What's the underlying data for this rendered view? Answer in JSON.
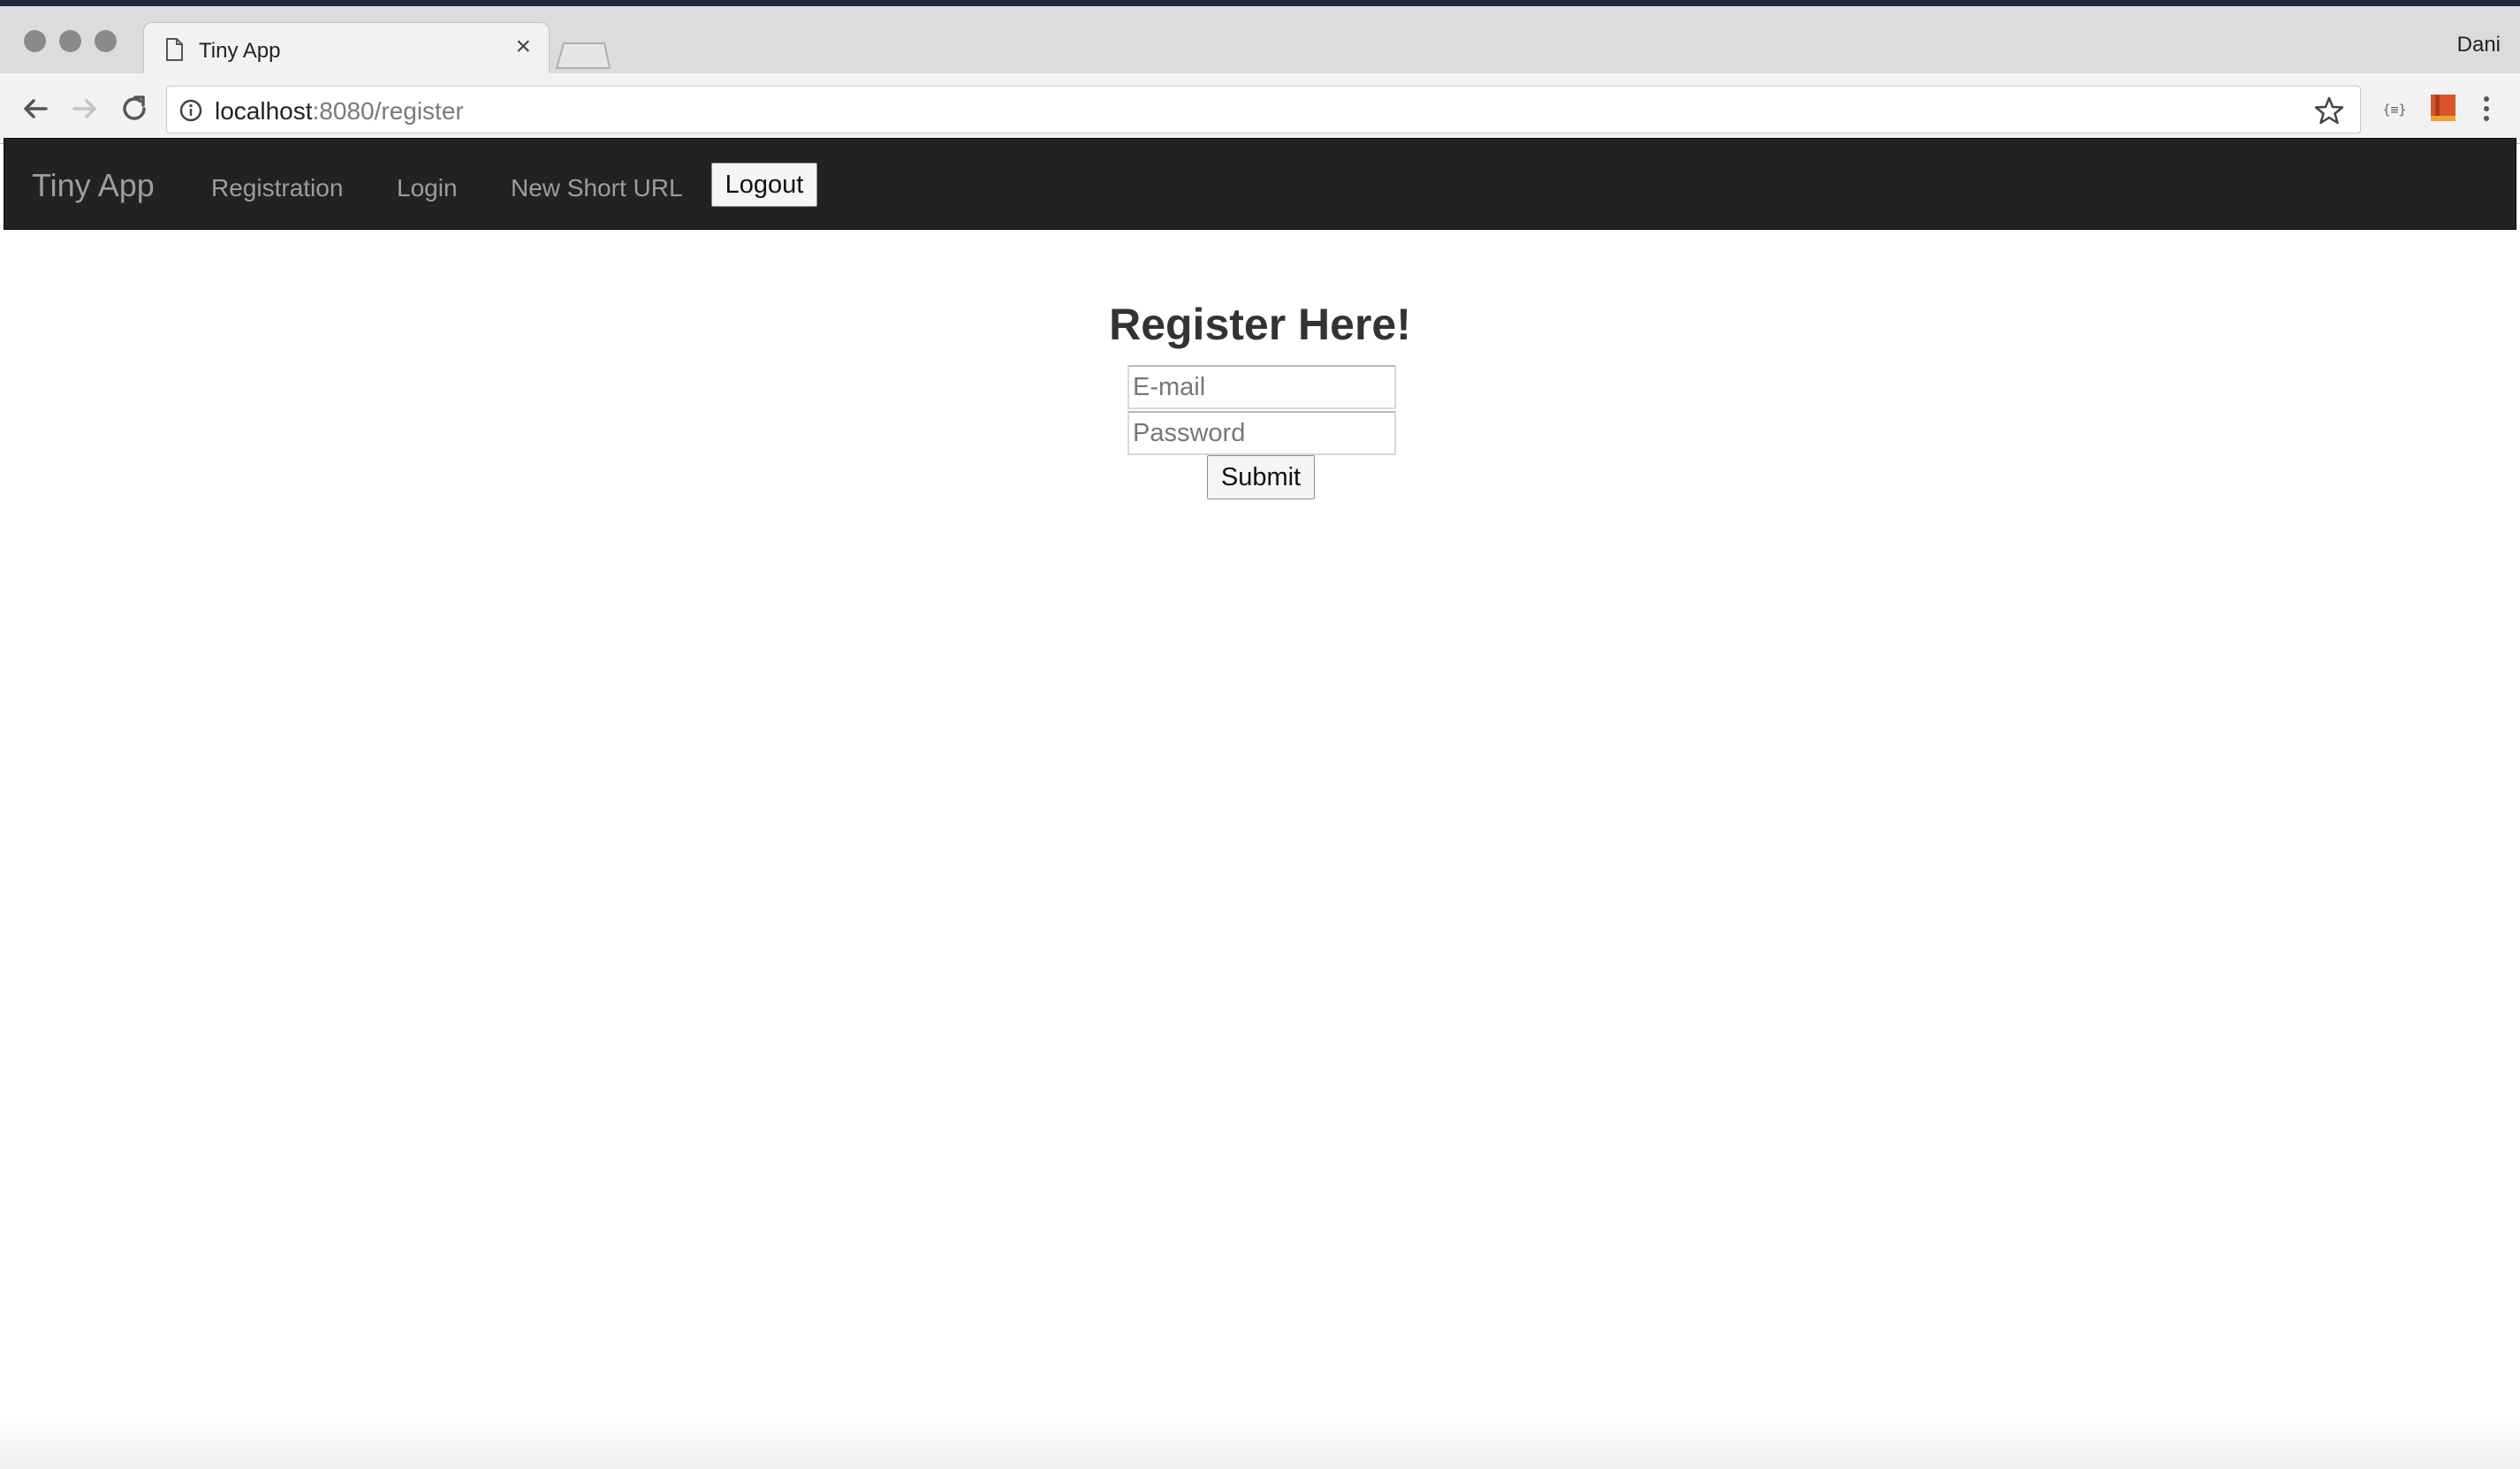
{
  "browser": {
    "tab": {
      "title": "Tiny App"
    },
    "profile_name": "Dani",
    "address": {
      "host": "localhost",
      "rest": ":8080/register"
    }
  },
  "navbar": {
    "brand": "Tiny App",
    "links": [
      "Registration",
      "Login",
      "New Short URL"
    ],
    "logout_label": "Logout"
  },
  "form": {
    "heading": "Register Here!",
    "email_placeholder": "E-mail",
    "password_placeholder": "Password",
    "submit_label": "Submit"
  },
  "colors": {
    "navbar_bg": "#222222",
    "nav_text": "#9d9d9d",
    "ext_icon": "#d9532b"
  }
}
